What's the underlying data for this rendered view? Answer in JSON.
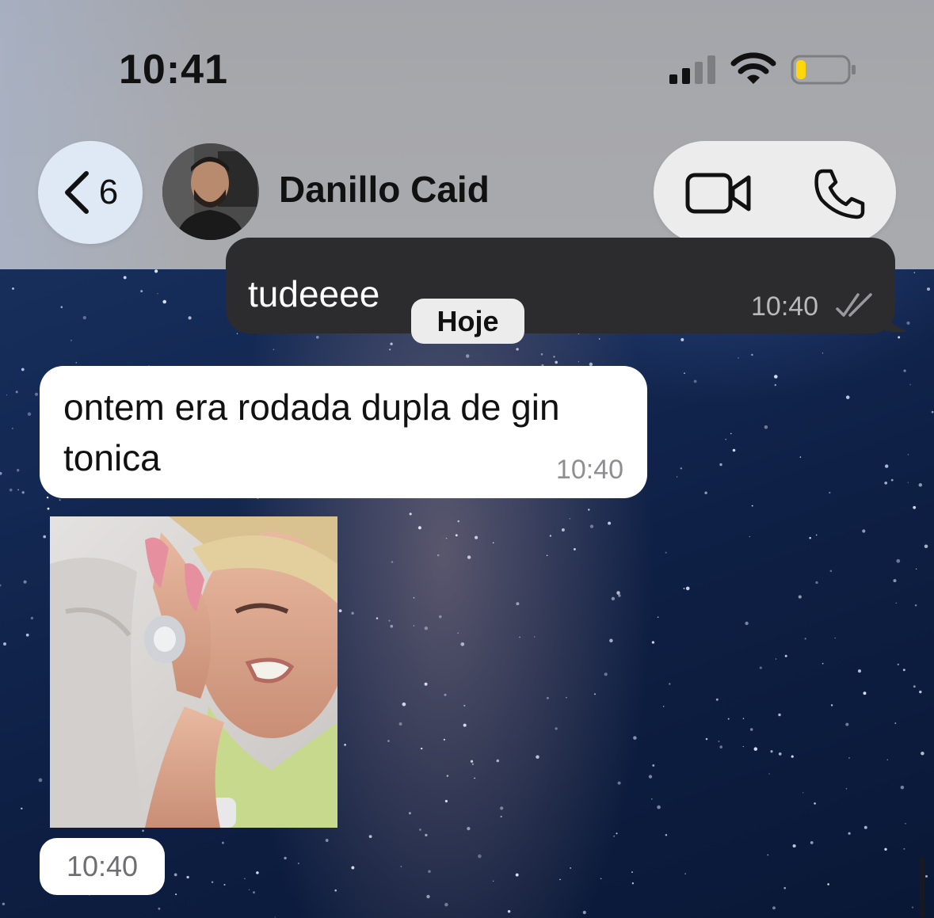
{
  "status_bar": {
    "time": "10:41"
  },
  "header": {
    "back_count": "6",
    "contact_name": "Danillo Caid",
    "icons": [
      "back-chevron-icon",
      "video-call-icon",
      "voice-call-icon"
    ]
  },
  "messages": {
    "outgoing_partial": {
      "text": "tudeeee",
      "time": "10:40",
      "status": "read"
    },
    "date_separator": "Hoje",
    "incoming_text": {
      "text": "ontem era rodada dupla de gin tonica",
      "time": "10:40"
    },
    "incoming_sticker": {
      "time": "10:40"
    }
  },
  "colors": {
    "header_bg": "#a7a8ac",
    "outgoing_bubble": "#2c2c2e",
    "incoming_bubble": "#ffffff",
    "battery_level": "#ffd60a"
  },
  "battery_level": 0.2,
  "signal_bars_active": 2
}
